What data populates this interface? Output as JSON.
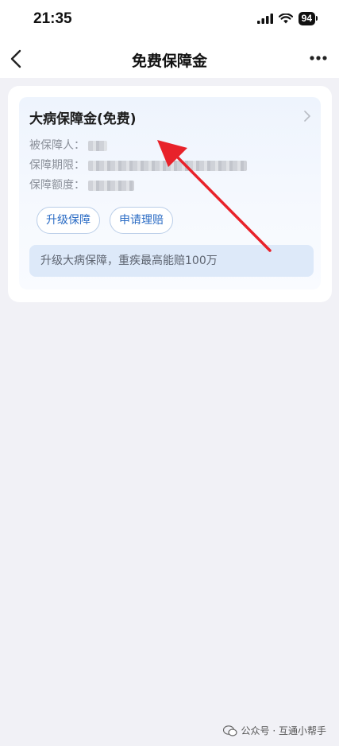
{
  "status_bar": {
    "time": "21:35",
    "battery": "94"
  },
  "nav": {
    "title": "免费保障金"
  },
  "card": {
    "title": "大病保障金(免费)",
    "insured_label": "被保障人：",
    "period_label": "保障期限：",
    "amount_label": "保障额度：",
    "upgrade_button": "升级保障",
    "claim_button": "申请理赔",
    "banner_text": "升级大病保障，重疾最高能赔100万"
  },
  "watermark": {
    "text": "公众号 · 互通小帮手"
  },
  "colors": {
    "accent_blue": "#2a6bc4",
    "annotation_red": "#e8222a",
    "page_bg": "#f1f1f6"
  }
}
